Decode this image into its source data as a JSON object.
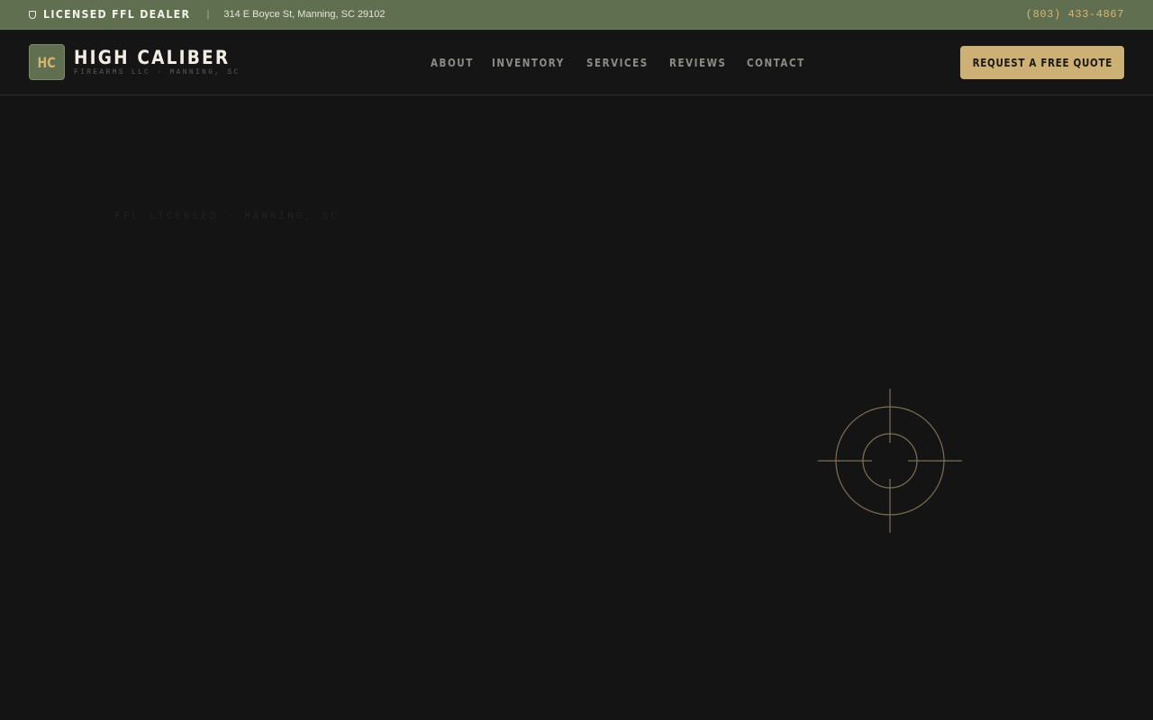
{
  "topbar": {
    "ffl_label": "LICENSED FFL DEALER",
    "separator": "|",
    "address": "314 E Boyce St, Manning, SC 29102",
    "phone": "(803) 433-4867"
  },
  "header": {
    "logo_initials": "HC",
    "brand_name": "HIGH CALIBER",
    "brand_sub": "FIREARMS LLC · MANNING, SC",
    "nav": [
      "ABOUT",
      "INVENTORY",
      "SERVICES",
      "REVIEWS",
      "CONTACT"
    ],
    "cta_label": "REQUEST A FREE QUOTE"
  },
  "hero": {
    "eyebrow": "· FFL LICENSED · MANNING, SC"
  },
  "colors": {
    "topbar_bg": "#5f6f4f",
    "accent_gold": "#cdb174",
    "page_bg": "#141414"
  },
  "icons": {
    "ffl": "shield-icon",
    "hero": "crosshair-icon"
  }
}
